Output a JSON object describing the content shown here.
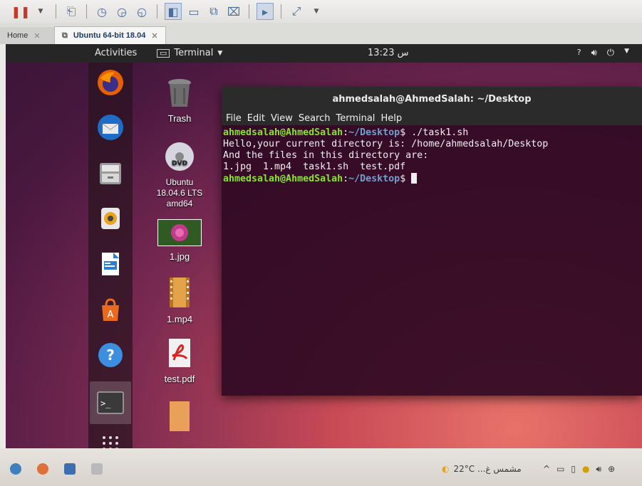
{
  "vm": {
    "tabs": [
      {
        "label": "Home"
      },
      {
        "label": "Ubuntu 64-bit 18.04"
      }
    ]
  },
  "topbar": {
    "activities": "Activities",
    "app_menu": "Terminal",
    "clock": "13:23 س"
  },
  "desktop": {
    "icons": [
      {
        "label": "Trash",
        "icon": "trash-icon"
      },
      {
        "label": "Ubuntu\n18.04.6 LTS\namd64",
        "icon": "dvd-icon"
      },
      {
        "label": "1.jpg",
        "icon": "image-file-icon"
      },
      {
        "label": "1.mp4",
        "icon": "video-file-icon"
      },
      {
        "label": "test.pdf",
        "icon": "pdf-file-icon"
      }
    ]
  },
  "terminal": {
    "title": "ahmedsalah@AhmedSalah: ~/Desktop",
    "menu": [
      "File",
      "Edit",
      "View",
      "Search",
      "Terminal",
      "Help"
    ],
    "prompt_user": "ahmedsalah@AhmedSalah",
    "prompt_path": "~/Desktop",
    "command": " ./task1.sh",
    "output": [
      "Hello,your current directory is: /home/ahmedsalah/Desktop",
      "And the files in this directory are:",
      "1.jpg  1.mp4  task1.sh  test.pdf"
    ]
  },
  "taskbar": {
    "weather": "22°C  ...مشمس غ"
  },
  "colors": {
    "prompt_user": "#8ae234",
    "prompt_path": "#729fcf",
    "terminal_bg": "#300a24",
    "topbar_bg": "#262626"
  }
}
